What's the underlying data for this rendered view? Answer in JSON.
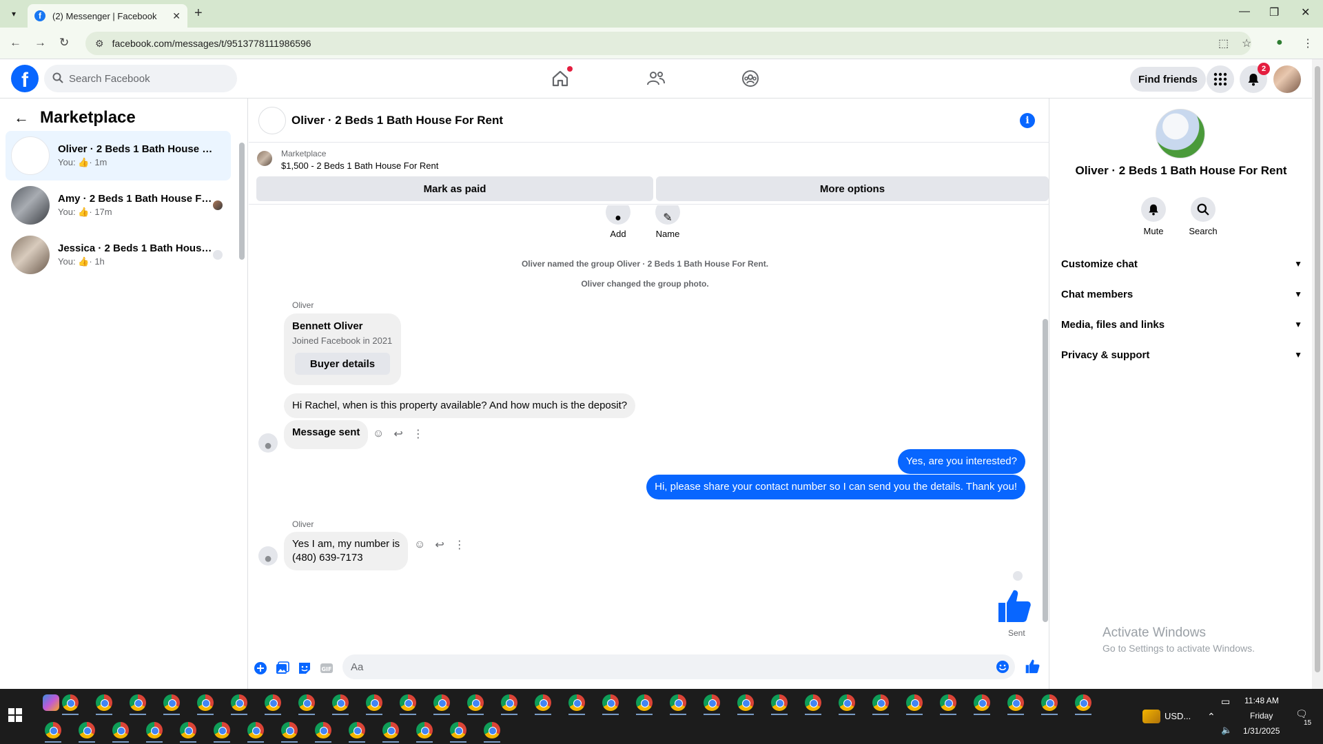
{
  "browser": {
    "tab_title": "(2) Messenger | Facebook",
    "url": "facebook.com/messages/t/9513778111986596"
  },
  "fb": {
    "search_placeholder": "Search Facebook",
    "find_friends": "Find friends",
    "notif_count": "2"
  },
  "sidebar": {
    "title": "Marketplace",
    "conversations": [
      {
        "name": "Oliver · 2 Beds 1 Bath House For...",
        "you": "You:",
        "time": "· 1m"
      },
      {
        "name": "Amy · 2 Beds 1 Bath House Fo...",
        "you": "You:",
        "time": "· 17m"
      },
      {
        "name": "Jessica · 2 Beds 1 Bath House ...",
        "you": "You:",
        "time": "· 1h"
      }
    ]
  },
  "chat": {
    "title": "Oliver · 2 Beds 1 Bath House For Rent",
    "marketplace_label": "Marketplace",
    "listing": "$1,500 - 2 Beds 1 Bath House For Rent",
    "mark_paid": "Mark as paid",
    "more_options": "More options",
    "group_actions": {
      "add": "Add",
      "name": "Name"
    },
    "system_msgs": [
      "Oliver named the group Oliver · 2 Beds 1 Bath House For Rent.",
      "Oliver changed the group photo."
    ],
    "sender": "Oliver",
    "card": {
      "name": "Bennett Oliver",
      "joined": "Joined Facebook in 2021",
      "button": "Buyer details"
    },
    "messages": {
      "in1": "Hi Rachel, when is this property available? And how much is the deposit?",
      "in2": "Message sent",
      "out1": "Yes, are you interested?",
      "out2": "Hi, please share your contact number so I can send you the details. Thank you!",
      "in3_line1": "Yes I am, my number is",
      "in3_line2": "(480) 639-7173"
    },
    "sent_label": "Sent",
    "composer_placeholder": "Aa"
  },
  "right_panel": {
    "name": "Oliver · 2 Beds 1 Bath House For Rent",
    "mute": "Mute",
    "search": "Search",
    "sections": [
      "Customize chat",
      "Chat members",
      "Media, files and links",
      "Privacy & support"
    ]
  },
  "watermark": {
    "line1": "Activate Windows",
    "line2": "Go to Settings to activate Windows."
  },
  "taskbar": {
    "currency": "USD...",
    "time": "11:48 AM",
    "day": "Friday",
    "date": "1/31/2025",
    "notif": "15"
  },
  "colors": {
    "brand": "#0866ff",
    "active_row": "#ebf5ff",
    "bubble_in": "#f0f0f0",
    "badge": "#e41e3f"
  }
}
